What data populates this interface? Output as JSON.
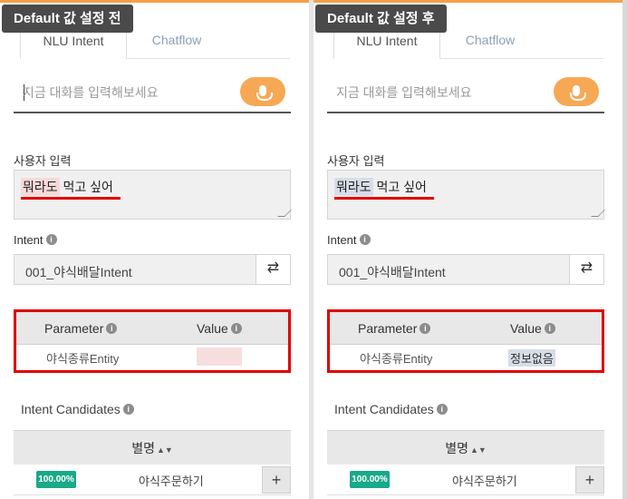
{
  "left": {
    "caption": "Default 값 설정 전",
    "tabs": [
      "NLU Intent",
      "Chatflow"
    ],
    "chat_placeholder": "지금 대화를 입력해보세요",
    "user_input_label": "사용자 입력",
    "utterance_highlight": "뭐라도",
    "utterance_rest": " 먹고 싶어",
    "intent_label": "Intent",
    "intent_value": "001_야식배달Intent",
    "param_header": "Parameter",
    "value_header": "Value",
    "param_name": "야식종류Entity",
    "param_value": "",
    "candidates_label": "Intent Candidates",
    "candidates_col": "별명",
    "candidate_pct": "100.00%",
    "candidate_name": "야식주문하기"
  },
  "right": {
    "caption": "Default 값 설정 후",
    "tabs": [
      "NLU Intent",
      "Chatflow"
    ],
    "chat_placeholder": "지금 대화를 입력해보세요",
    "user_input_label": "사용자 입력",
    "utterance_highlight": "뭐라도",
    "utterance_rest": " 먹고 싶어",
    "intent_label": "Intent",
    "intent_value": "001_야식배달Intent",
    "param_header": "Parameter",
    "value_header": "Value",
    "param_name": "야식종류Entity",
    "param_value": "정보없음",
    "candidates_label": "Intent Candidates",
    "candidates_col": "별명",
    "candidate_pct": "100.00%",
    "candidate_name": "야식주문하기"
  },
  "colors": {
    "accent": "#f7a854",
    "alert_red": "#e00000",
    "badge_green": "#1aa989",
    "highlight_pink": "#f7d9d9",
    "highlight_blue": "#d7dde8"
  },
  "icons": {
    "info": "i",
    "swap": "⇄",
    "sort": "▲▼",
    "add": "+"
  }
}
